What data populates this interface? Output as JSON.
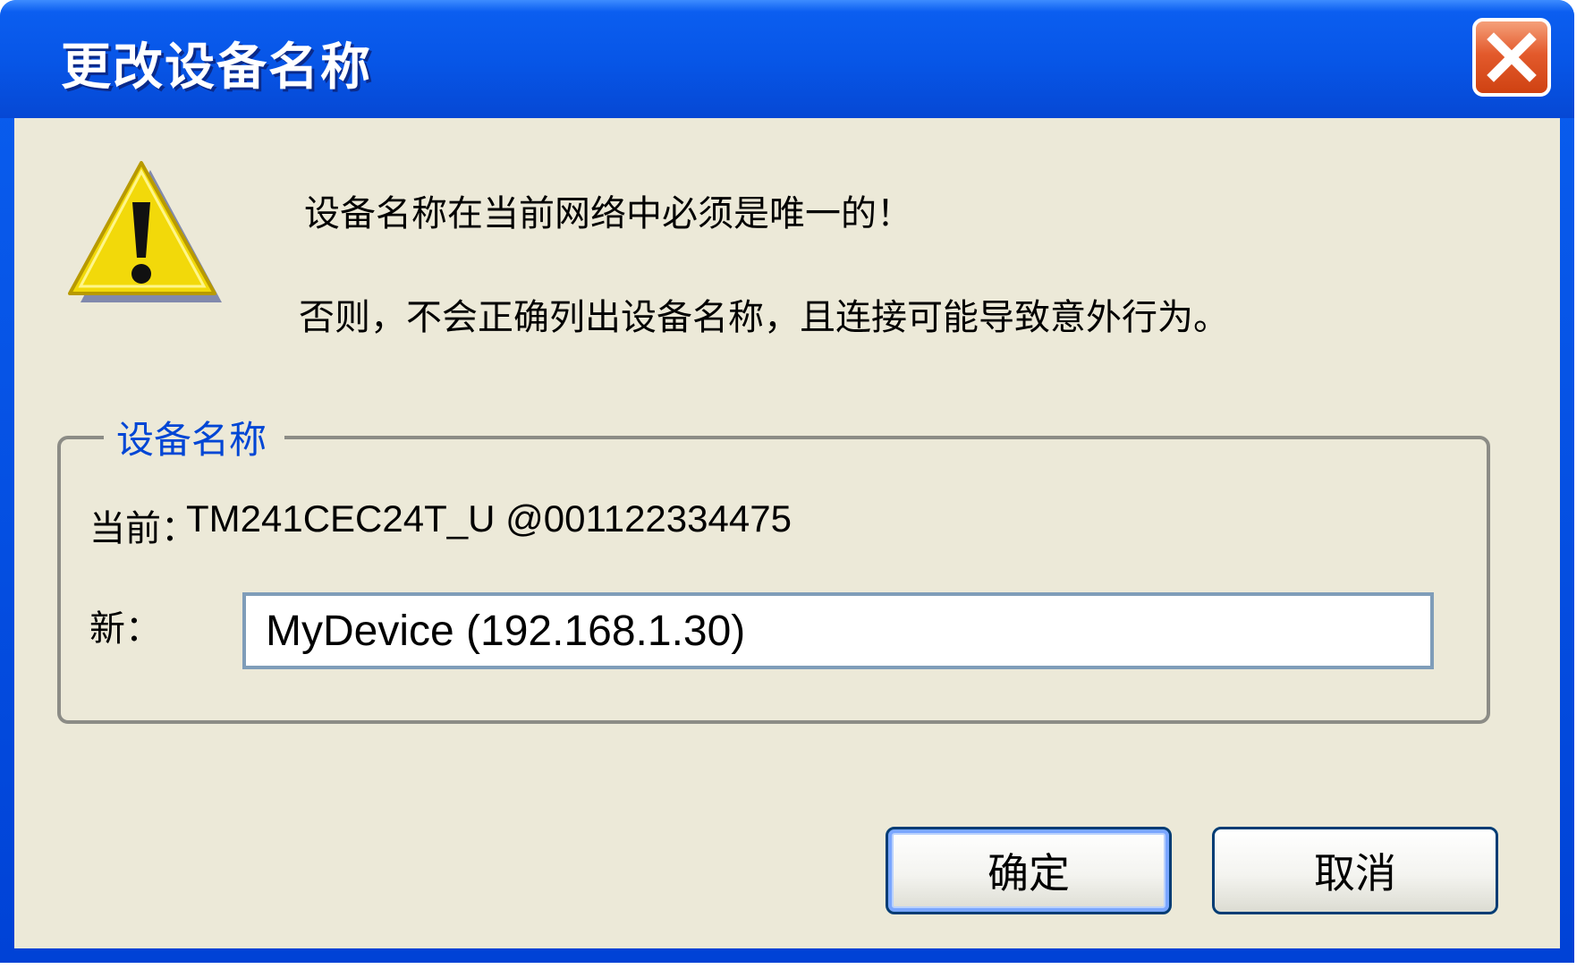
{
  "window": {
    "title": "更改设备名称"
  },
  "message": {
    "line1": "设备名称在当前网络中必须是唯一的！",
    "line2": "否则，不会正确列出设备名称，且连接可能导致意外行为。"
  },
  "group": {
    "legend": "设备名称",
    "current_label": "当前：",
    "current_value": "TM241CEC24T_U @001122334475",
    "new_label": "新：",
    "new_value": "MyDevice (192.168.1.30)"
  },
  "buttons": {
    "ok_label": "确定",
    "cancel_label": "取消"
  },
  "icons": {
    "close": "close-icon",
    "warning": "warning-icon"
  },
  "colors": {
    "titlebar": "#0755e6",
    "client_bg": "#ece9d8",
    "legend_text": "#0046d5",
    "close_button": "#e35a2c",
    "warning_fill": "#f2d90a"
  }
}
